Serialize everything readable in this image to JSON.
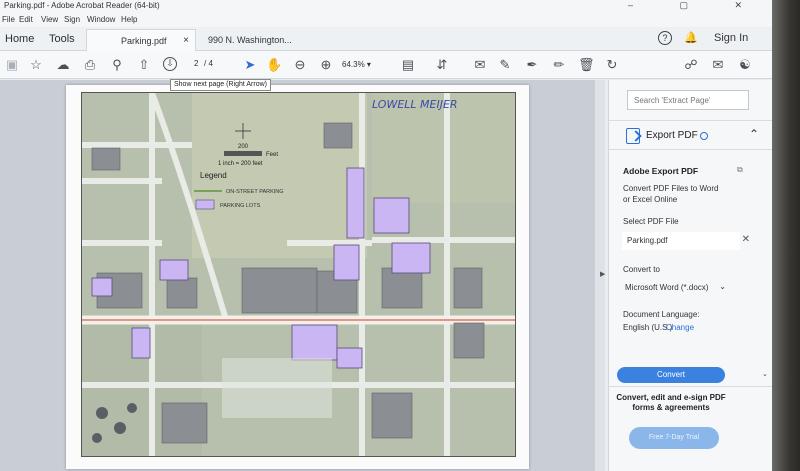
{
  "window": {
    "title": "Parking.pdf - Adobe Acrobat Reader (64-bit)",
    "controls": "–  ▢  ✕"
  },
  "menu": [
    "File",
    "Edit",
    "View",
    "Sign",
    "Window",
    "Help"
  ],
  "nav": {
    "home": "Home",
    "tools": "Tools"
  },
  "tabs": [
    {
      "label": "Parking.pdf",
      "close": "×"
    },
    {
      "label": "990 N. Washington..."
    }
  ],
  "account": {
    "help": "?",
    "sign_in": "Sign In"
  },
  "toolbar": {
    "page_current": "2",
    "page_total": "/ 4",
    "zoom": "64.3%",
    "tooltip": "Show next page (Right Arrow)"
  },
  "icons": {
    "save": "save-icon",
    "bookmark": "star-icon",
    "upload": "upload-cloud-icon",
    "print": "print-icon",
    "find": "search-icon",
    "prev": "prev-page-icon",
    "next": "next-page-icon",
    "select": "cursor-icon",
    "hand": "hand-icon",
    "zoom_out": "zoom-out-icon",
    "zoom_in": "zoom-in-icon",
    "fit": "fit-page-icon",
    "scroll": "scroll-mode-icon",
    "comment": "comment-icon",
    "highlight": "pen-icon",
    "sign": "sign-icon",
    "edit": "edit-icon",
    "delete": "trash-icon",
    "rotate": "rotate-icon",
    "share": "share-icon",
    "email": "email-icon",
    "bell": "bell-icon"
  },
  "map": {
    "handwriting": "LOWELL    MEIJER",
    "scale_label": "200",
    "scale_unit": "Feet",
    "scale_ratio": "1 inch = 200 feet",
    "legend_title": "Legend",
    "legend_street": "ON-STREET PARKING",
    "legend_lots": "PARKING LOTS",
    "lot_color": "#c9b6f2",
    "street_color": "#e0613f"
  },
  "panel": {
    "search_placeholder": "Search 'Extract Page'",
    "export_label": "Export PDF",
    "section_title": "Adobe Export PDF",
    "desc_line1": "Convert PDF Files to Word",
    "desc_line2": "or Excel Online",
    "select_label": "Select PDF File",
    "file_name": "Parking.pdf",
    "convert_to_label": "Convert to",
    "format": "Microsoft Word (*.docx)",
    "lang_label": "Document Language:",
    "lang_value": "English (U.S.)",
    "lang_change": "Change",
    "convert_button": "Convert",
    "promo_line1": "Convert, edit and e-sign PDF",
    "promo_line2": "forms & agreements",
    "trial_button": "Free 7-Day Trial"
  }
}
